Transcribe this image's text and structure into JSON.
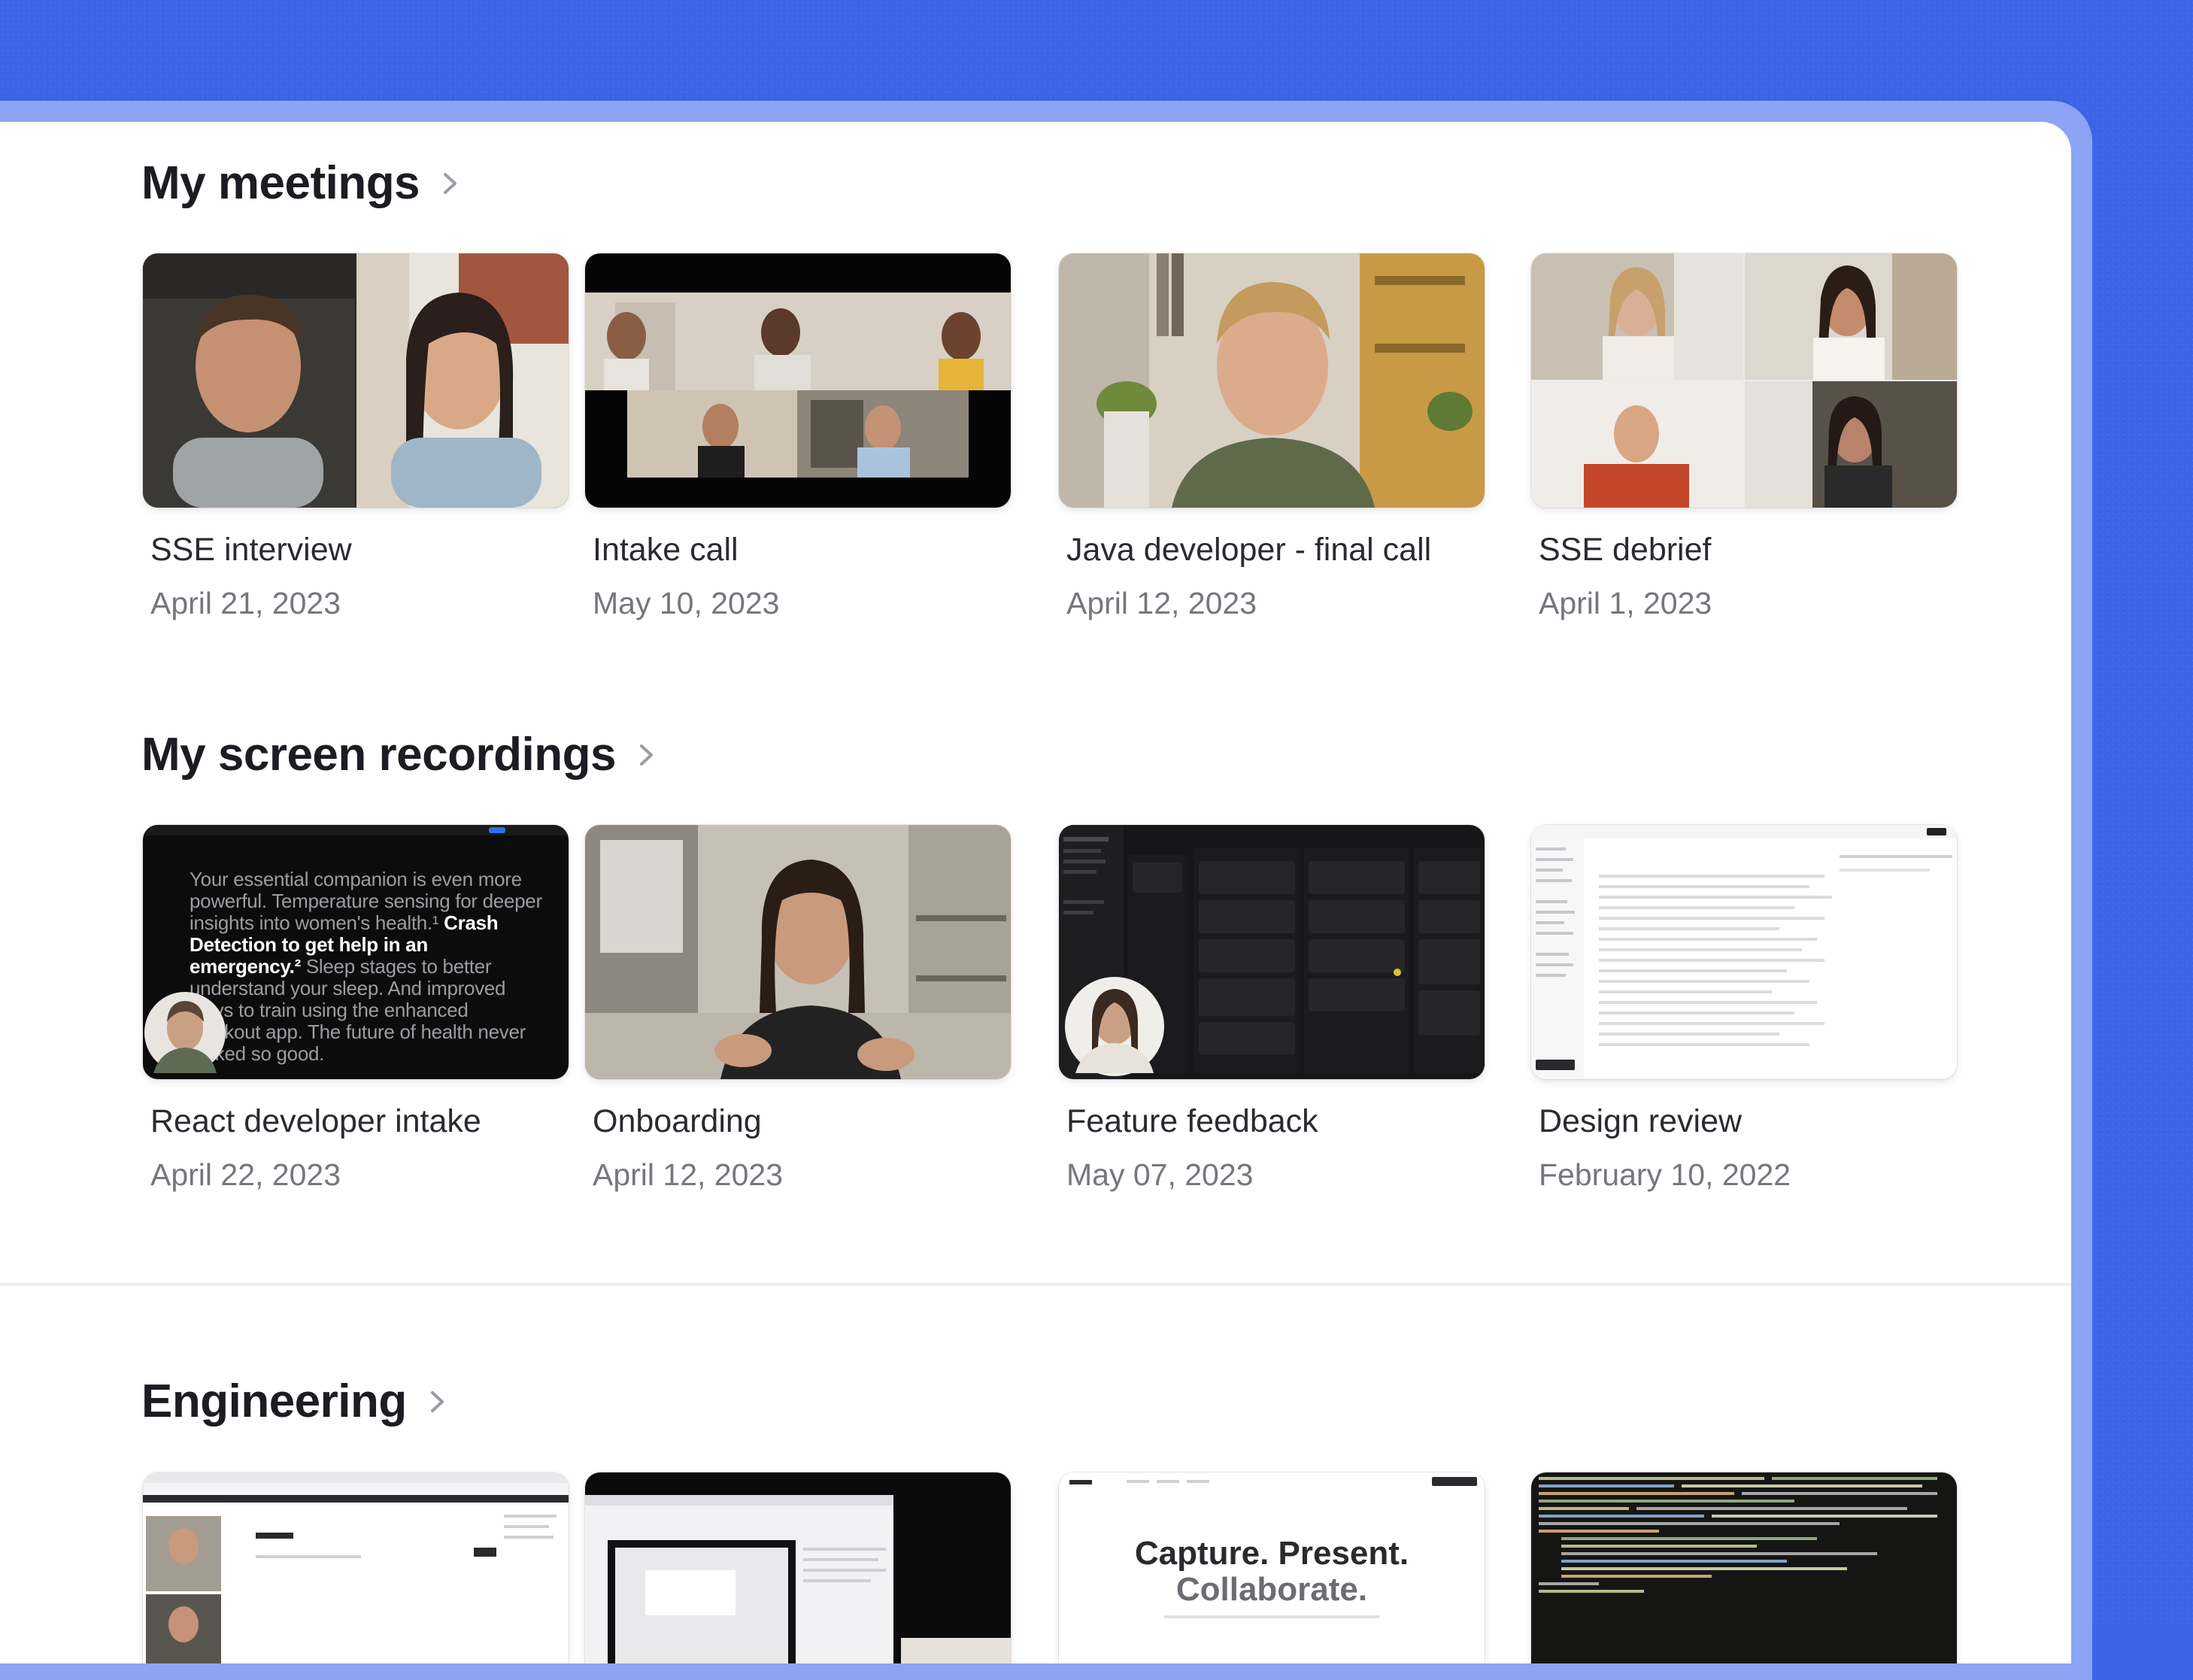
{
  "sections": [
    {
      "title": "My meetings",
      "items": [
        {
          "title": "SSE interview",
          "date": "April 21, 2023"
        },
        {
          "title": "Intake call",
          "date": "May 10, 2023"
        },
        {
          "title": "Java developer - final call",
          "date": "April 12, 2023"
        },
        {
          "title": "SSE debrief",
          "date": "April 1, 2023"
        }
      ]
    },
    {
      "title": "My screen recordings",
      "items": [
        {
          "title": "React developer intake",
          "date": "April 22, 2023"
        },
        {
          "title": "Onboarding",
          "date": "April 12, 2023"
        },
        {
          "title": "Feature feedback",
          "date": "May 07, 2023"
        },
        {
          "title": "Design review",
          "date": "February 10, 2022"
        }
      ]
    },
    {
      "title": "Engineering",
      "items": []
    }
  ],
  "thumb_text": {
    "react_intake": {
      "part1": "Your essential companion is even more powerful. Temperature sensing for deeper insights into women's health.¹ ",
      "bold": "Crash Detection to get help in an emergency.²",
      "part2": " Sleep stages to better understand your sleep. And improved ways to train using the enhanced Workout app. The future of health never looked so good."
    },
    "engineering_3": {
      "line1": "Capture. Present.",
      "line2": "Collaborate."
    }
  },
  "colors": {
    "background": "#3d63e6",
    "frame": "#8da3f4",
    "panel": "#ffffff",
    "title": "#1c1d22",
    "date": "#75777e"
  }
}
